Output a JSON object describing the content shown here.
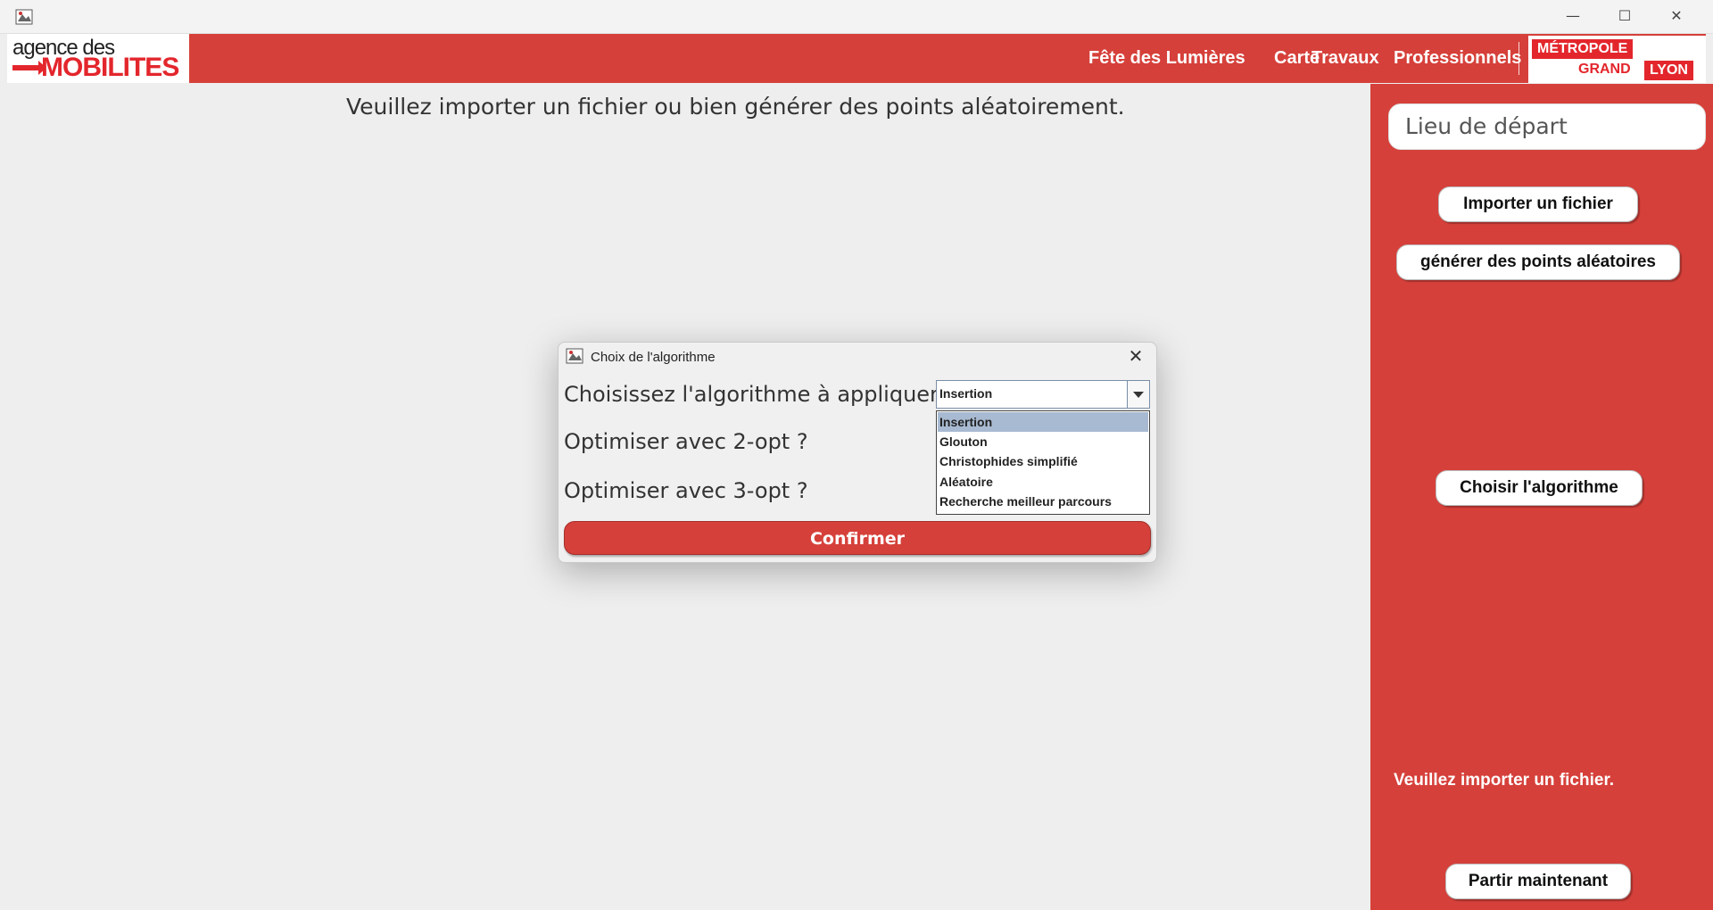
{
  "window": {
    "icon": "java-app-icon",
    "minimize_glyph": "—",
    "maximize_glyph": "☐",
    "close_glyph": "✕"
  },
  "header": {
    "logo_line1": "agence des",
    "logo_line2": "MOBILITES",
    "nav": [
      "Fête des Lumières",
      "Carte",
      "Travaux",
      "Professionnels"
    ],
    "metro_line1": "MÉTROPOLE",
    "metro_line2a": "GRAND",
    "metro_line2b": "LYON",
    "accent": "#d6403a"
  },
  "main": {
    "message": "Veuillez importer un fichier ou bien générer des points aléatoirement."
  },
  "sidebar": {
    "start_placeholder": "Lieu de départ",
    "import_button": "Importer un fichier",
    "generate_button": "générer des points aléatoires",
    "algo_button": "Choisir l'algorithme",
    "status": "Veuillez importer un fichier.",
    "go_button": "Partir maintenant"
  },
  "dialog": {
    "title": "Choix de l'algorithme",
    "close_glyph": "✕",
    "algo_label": "Choisissez l'algorithme à appliquer :",
    "opt2_label": "Optimiser avec 2-opt ?",
    "opt3_label": "Optimiser avec 3-opt ?",
    "selected": "Insertion",
    "options": [
      "Insertion",
      "Glouton",
      "Christophides simplifié",
      "Aléatoire",
      "Recherche meilleur parcours"
    ],
    "confirm": "Confirmer"
  }
}
